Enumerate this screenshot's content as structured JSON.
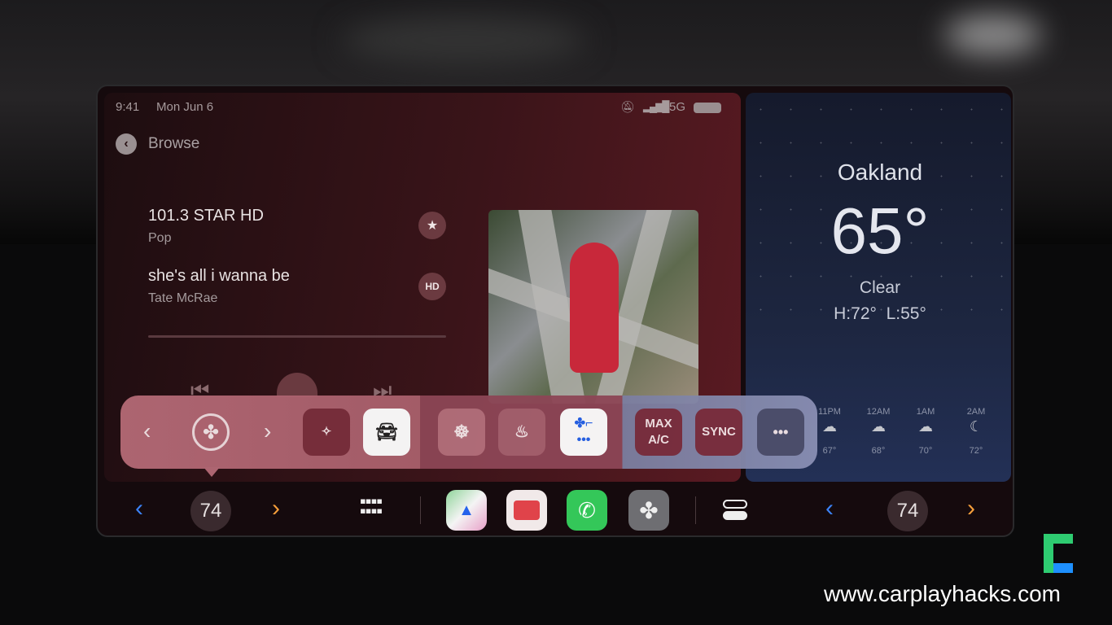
{
  "status_bar": {
    "time": "9:41",
    "date": "Mon Jun 6",
    "network": "5G"
  },
  "nav": {
    "back_label": "Browse"
  },
  "now_playing": {
    "station": "101.3 STAR HD",
    "genre": "Pop",
    "song": "she's all i wanna be",
    "artist": "Tate McRae",
    "progress": 0
  },
  "weather": {
    "city": "Oakland",
    "temp": "65°",
    "condition": "Clear",
    "high_low": "H:72°  L:55°",
    "hourly": [
      {
        "time": "11PM",
        "temp": "67°",
        "icon": "cloud-moon-rain"
      },
      {
        "time": "12AM",
        "temp": "68°",
        "icon": "cloud-thunder"
      },
      {
        "time": "1AM",
        "temp": "70°",
        "icon": "cloud-moon"
      },
      {
        "time": "2AM",
        "temp": "72°",
        "icon": "moon-stars"
      }
    ]
  },
  "climate": {
    "max_ac": "MAX\nA/C",
    "sync": "SYNC",
    "more": "•••"
  },
  "dock": {
    "left_temp": "74",
    "right_temp": "74"
  },
  "watermark": "www.carplayhacks.com",
  "colors": {
    "accent_blue": "#3b82f6",
    "accent_orange": "#f59e3b",
    "phone_green": "#34c759"
  }
}
